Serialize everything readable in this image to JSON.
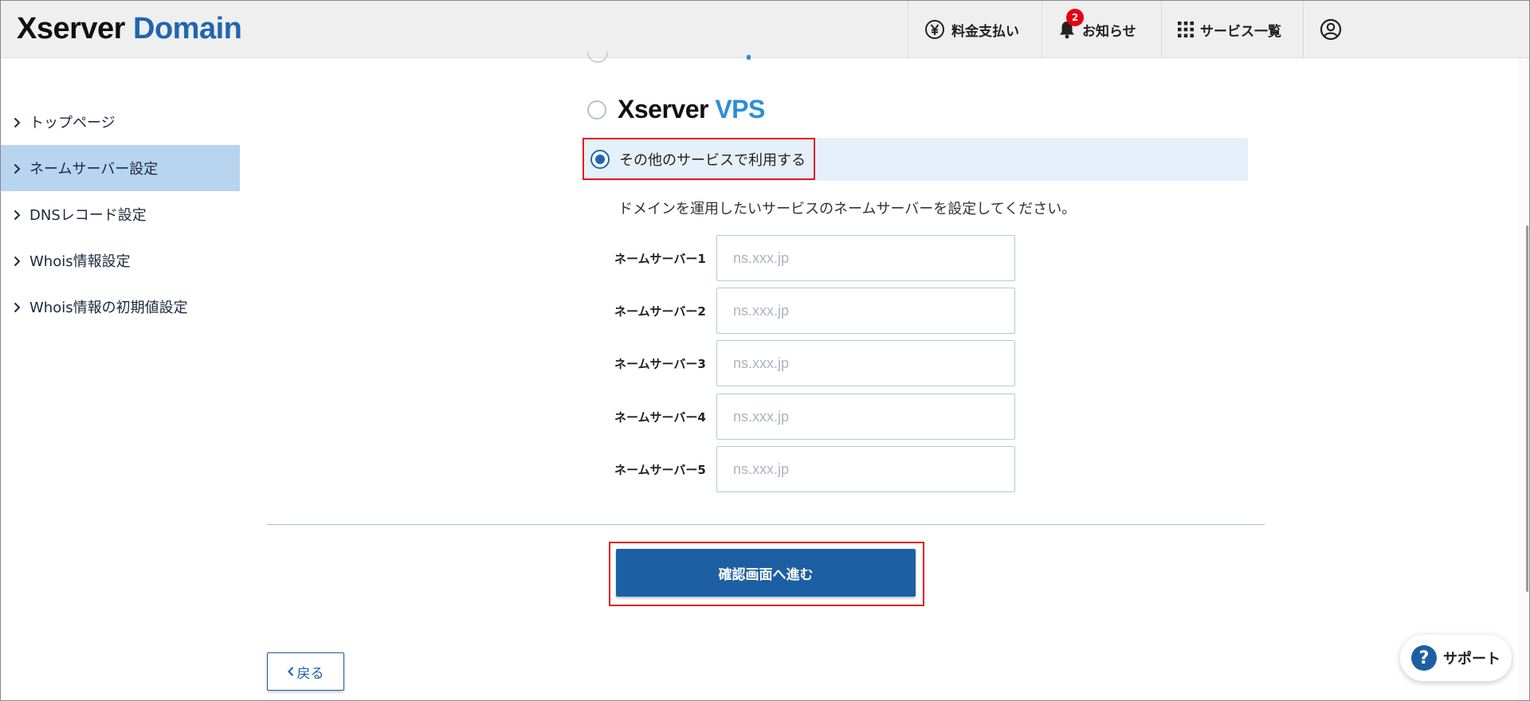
{
  "header": {
    "logo_part1": "Xserver",
    "logo_part2": "Domain",
    "billing": "料金支払い",
    "notifications": "お知らせ",
    "notifications_badge": "2",
    "services": "サービス一覧"
  },
  "sidebar": {
    "items": [
      {
        "label": "トップページ"
      },
      {
        "label": "ネームサーバー設定"
      },
      {
        "label": "DNSレコード設定"
      },
      {
        "label": "Whois情報設定"
      },
      {
        "label": "Whois情報の初期値設定"
      }
    ]
  },
  "main": {
    "vps_logo_part1": "Xserver",
    "vps_logo_part2": "VPS",
    "other_service_label": "その他のサービスで利用する",
    "description": "ドメインを運用したいサービスのネームサーバーを設定してください。",
    "nameservers": [
      {
        "label": "ネームサーバー1",
        "placeholder": "ns.xxx.jp",
        "value": ""
      },
      {
        "label": "ネームサーバー2",
        "placeholder": "ns.xxx.jp",
        "value": ""
      },
      {
        "label": "ネームサーバー3",
        "placeholder": "ns.xxx.jp",
        "value": ""
      },
      {
        "label": "ネームサーバー4",
        "placeholder": "ns.xxx.jp",
        "value": ""
      },
      {
        "label": "ネームサーバー5",
        "placeholder": "ns.xxx.jp",
        "value": ""
      }
    ],
    "submit_label": "確認画面へ進む",
    "back_label": "戻る"
  },
  "support_label": "サポート",
  "colors": {
    "brand_blue": "#2066ae",
    "button_blue": "#1d5fa3",
    "active_nav": "#b8d4ef",
    "highlight_band": "#e6f0fa",
    "annotation_red": "#e4161d"
  }
}
